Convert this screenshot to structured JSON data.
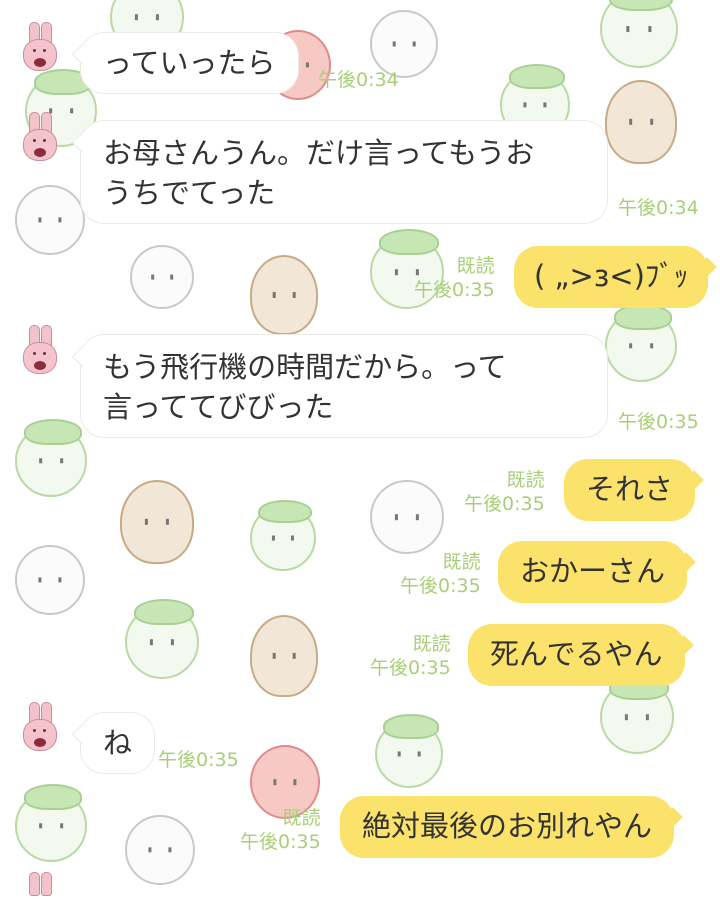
{
  "messages": [
    {
      "from": "friend",
      "text": "っていったら",
      "time": "午後0:34"
    },
    {
      "from": "friend",
      "lines": [
        "お母さんうん。だけ言ってもうお",
        "うちでてった"
      ],
      "time": "午後0:34"
    },
    {
      "from": "me",
      "text": "( „>з<)ﾌﾞｯ",
      "read": "既読",
      "time": "午後0:35"
    },
    {
      "from": "friend",
      "lines": [
        "もう飛行機の時間だから。って",
        "言っててびびった"
      ],
      "time": "午後0:35"
    },
    {
      "from": "me",
      "text": "それさ",
      "read": "既読",
      "time": "午後0:35"
    },
    {
      "from": "me",
      "text": "おかーさん",
      "read": "既読",
      "time": "午後0:35"
    },
    {
      "from": "me",
      "text": "死んでるやん",
      "read": "既読",
      "time": "午後0:35"
    },
    {
      "from": "friend",
      "text": "ね",
      "time": "午後0:35"
    },
    {
      "from": "me",
      "text": "絶対最後のお別れやん",
      "read": "既読",
      "time": "午後0:35"
    }
  ],
  "colors": {
    "outgoing_bubble": "#fbe26b",
    "incoming_bubble": "#ffffff",
    "meta_text": "#a8cf78",
    "message_text": "#333333"
  },
  "icons": {
    "friend_avatar": "pink-rabbit-avatar-icon"
  }
}
